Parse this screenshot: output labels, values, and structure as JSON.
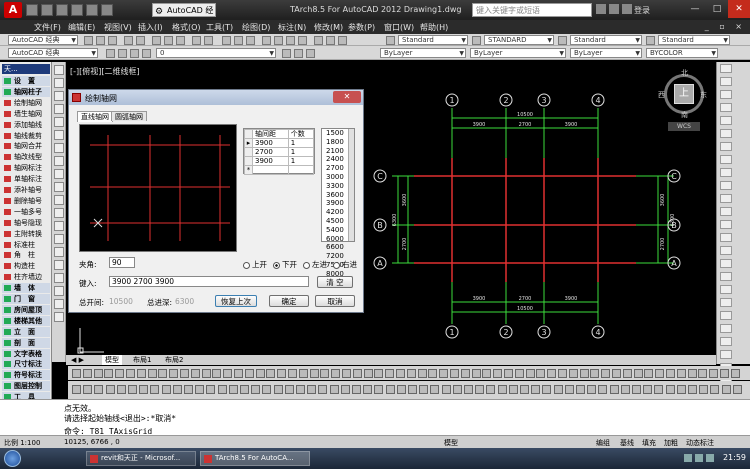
{
  "titlebar": {
    "logo": "A",
    "workspace": "AutoCAD 经典",
    "title": "TArch8.5 For AutoCAD 2012   Drawing1.dwg",
    "search_placeholder": "键入关键字或短语",
    "login": "登录",
    "controls": [
      "—",
      "□",
      "✕"
    ]
  },
  "menubar": {
    "items": [
      "文件(F)",
      "编辑(E)",
      "视图(V)",
      "插入(I)",
      "格式(O)",
      "工具(T)",
      "绘图(D)",
      "标注(N)",
      "修改(M)",
      "参数(P)",
      "窗口(W)",
      "帮助(H)"
    ],
    "window_controls": "_ ▫ ×"
  },
  "toolbar1": {
    "workspace2": "AutoCAD 经典",
    "textstyle": "Standard",
    "dimstyle": "STANDARD",
    "tablestyle": "Standard",
    "mleaderstyle": "Standard"
  },
  "toolbar2": {
    "layer": "0",
    "color": "ByLayer",
    "linetype": "ByLayer",
    "lineweight": "ByLayer",
    "plotstyle": "BYCOLOR"
  },
  "palette": {
    "header": "天...",
    "items": [
      {
        "label": "设　置",
        "group": true
      },
      {
        "label": "轴网柱子",
        "group": true
      },
      {
        "label": "绘制轴网",
        "group": false
      },
      {
        "label": "墙生轴网",
        "group": false
      },
      {
        "label": "添加轴线",
        "group": false
      },
      {
        "label": "轴线裁剪",
        "group": false
      },
      {
        "label": "轴网合并",
        "group": false
      },
      {
        "label": "轴改线型",
        "group": false
      },
      {
        "label": "轴网标注",
        "group": false
      },
      {
        "label": "单轴标注",
        "group": false
      },
      {
        "label": "添补轴号",
        "group": false
      },
      {
        "label": "删除轴号",
        "group": false
      },
      {
        "label": "一轴多号",
        "group": false
      },
      {
        "label": "轴号隐现",
        "group": false
      },
      {
        "label": "主附转换",
        "group": false
      },
      {
        "label": "标准柱",
        "group": false
      },
      {
        "label": "角　柱",
        "group": false
      },
      {
        "label": "构造柱",
        "group": false
      },
      {
        "label": "柱齐墙边",
        "group": false
      },
      {
        "label": "墙　体",
        "group": true
      },
      {
        "label": "门　窗",
        "group": true
      },
      {
        "label": "房间屋顶",
        "group": true
      },
      {
        "label": "楼梯其他",
        "group": true
      },
      {
        "label": "立　面",
        "group": true
      },
      {
        "label": "剖　面",
        "group": true
      },
      {
        "label": "文字表格",
        "group": true
      },
      {
        "label": "尺寸标注",
        "group": true
      },
      {
        "label": "符号标注",
        "group": true
      },
      {
        "label": "图层控制",
        "group": true
      },
      {
        "label": "工　具",
        "group": true
      },
      {
        "label": "三维建模",
        "group": true
      },
      {
        "label": "图块图案",
        "group": true
      }
    ]
  },
  "view_label": "[-][俯视][二维线框]",
  "viewcube": {
    "north": "北",
    "south": "南",
    "east": "东",
    "west": "西",
    "top": "上",
    "wcs": "WCS"
  },
  "drawing": {
    "axis_numbers": [
      "1",
      "2",
      "3",
      "4"
    ],
    "axis_letters": [
      "A",
      "B",
      "C"
    ],
    "top_total": "10500",
    "top_dims": [
      "3900",
      "2700",
      "3900"
    ],
    "bottom_dims": [
      "3900",
      "2700",
      "3900"
    ],
    "bottom_total": "10500",
    "left_dims": [
      "2700",
      "3600"
    ],
    "left_total": "6300",
    "right_dims": [
      "2700",
      "3600"
    ],
    "right_total": "6300"
  },
  "dialog": {
    "title": "绘制轴网",
    "close": "✕",
    "tab_straight": "直线轴网",
    "tab_arc": "圆弧轴网",
    "table_headers": [
      "轴间距",
      "个数"
    ],
    "table_rows": [
      [
        "3900",
        "1"
      ],
      [
        "2700",
        "1"
      ],
      [
        "3900",
        "1"
      ]
    ],
    "distances": [
      "1500",
      "1800",
      "2100",
      "2400",
      "2700",
      "3000",
      "3300",
      "3600",
      "3900",
      "4200",
      "4500",
      "5400",
      "6000",
      "6600",
      "7200",
      "7500",
      "8000"
    ],
    "angle_label": "夹角:",
    "angle_value": "90",
    "radio_options": [
      "上开",
      "下开",
      "左进",
      "右进"
    ],
    "radio_selected": "下开",
    "input_label": "键入:",
    "input_value": "3900 2700 3900",
    "clear_btn": "清 空",
    "total_open_label": "总开间:",
    "total_open_value": "10500",
    "total_depth_label": "总进深:",
    "total_depth_value": "6300",
    "restore_btn": "恢复上次",
    "ok_btn": "确定",
    "cancel_btn": "取消"
  },
  "modeltabs": {
    "model": "模型",
    "layout1": "布局1",
    "layout2": "布局2"
  },
  "command": {
    "line1": "点无效。",
    "line2": "请选择起始轴线<退出>:*取消*",
    "prompt": "命令: T81_TAxisGrid"
  },
  "statusbar": {
    "scale": "比例 1:100",
    "coords": "10125, 6766 , 0",
    "model": "模型",
    "edit": "编组",
    "base": "基线",
    "fill": "填充",
    "bold": "加粗",
    "dynamic": "动态标注"
  },
  "taskbar": {
    "tasks": [
      "revit和天正 - Microsof...",
      "TArch8.5 For AutoCA..."
    ],
    "clock": "21:59"
  }
}
